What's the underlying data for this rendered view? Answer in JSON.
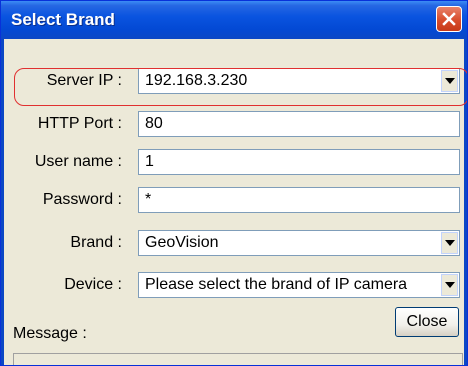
{
  "window": {
    "title": "Select Brand"
  },
  "form": {
    "server_ip": {
      "label": "Server IP :",
      "value": "192.168.3.230"
    },
    "http_port": {
      "label": "HTTP Port :",
      "value": "80"
    },
    "user_name": {
      "label": "User name :",
      "value": "1"
    },
    "password": {
      "label": "Password :",
      "value": "*"
    },
    "brand": {
      "label": "Brand :",
      "value": "GeoVision"
    },
    "device": {
      "label": "Device :",
      "value": "Please select the brand of IP camera"
    }
  },
  "buttons": {
    "close_label": "Close"
  },
  "message": {
    "label": "Message :"
  },
  "colors": {
    "title_bar": "#0a54e0",
    "highlight": "#e03030",
    "close_icon_bg": "#d84d2c"
  }
}
